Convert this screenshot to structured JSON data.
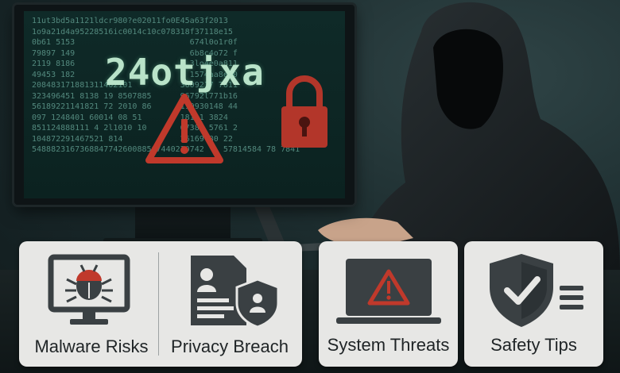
{
  "screen": {
    "code": "24otjxa",
    "digit_lines": [
      "11ut3bd5a1121ldcr980?e02011fo0E45a63f2013",
      "1o9a21d4a95228516ic0014c10c078318f37118e15",
      "0b61 5153                        674l0o1r0f",
      "79897 149                        6b8c4o72 f",
      "2119 8186                        3lo4e0a811",
      "49453 182                        1574aa8e10",
      "208483171881311402101          3609217 7611",
      "323496451 8138 19 8507885      96792l771b16",
      "56189221141821 72 2010 86      119930148 44",
      "097 1248401 60014 08 51        18111 3824",
      "851124888111 4 2l1010 10       67384 5761 2",
      "104872291467521 814            26169 80 22",
      "548882316736884774260088567440230742    57814584 78 7841"
    ]
  },
  "cards": [
    {
      "label": "Malware Risks",
      "icon": "bug-on-monitor-icon"
    },
    {
      "label": "Privacy Breach",
      "icon": "id-document-shield-icon"
    },
    {
      "label": "System Threats",
      "icon": "laptop-warning-icon"
    },
    {
      "label": "Safety Tips",
      "icon": "shield-checklist-icon"
    }
  ],
  "colors": {
    "warning_red": "#c0392b",
    "icon_dark": "#3a4043",
    "card_bg": "#e7e7e5",
    "screen_text": "#b9e3c9"
  }
}
